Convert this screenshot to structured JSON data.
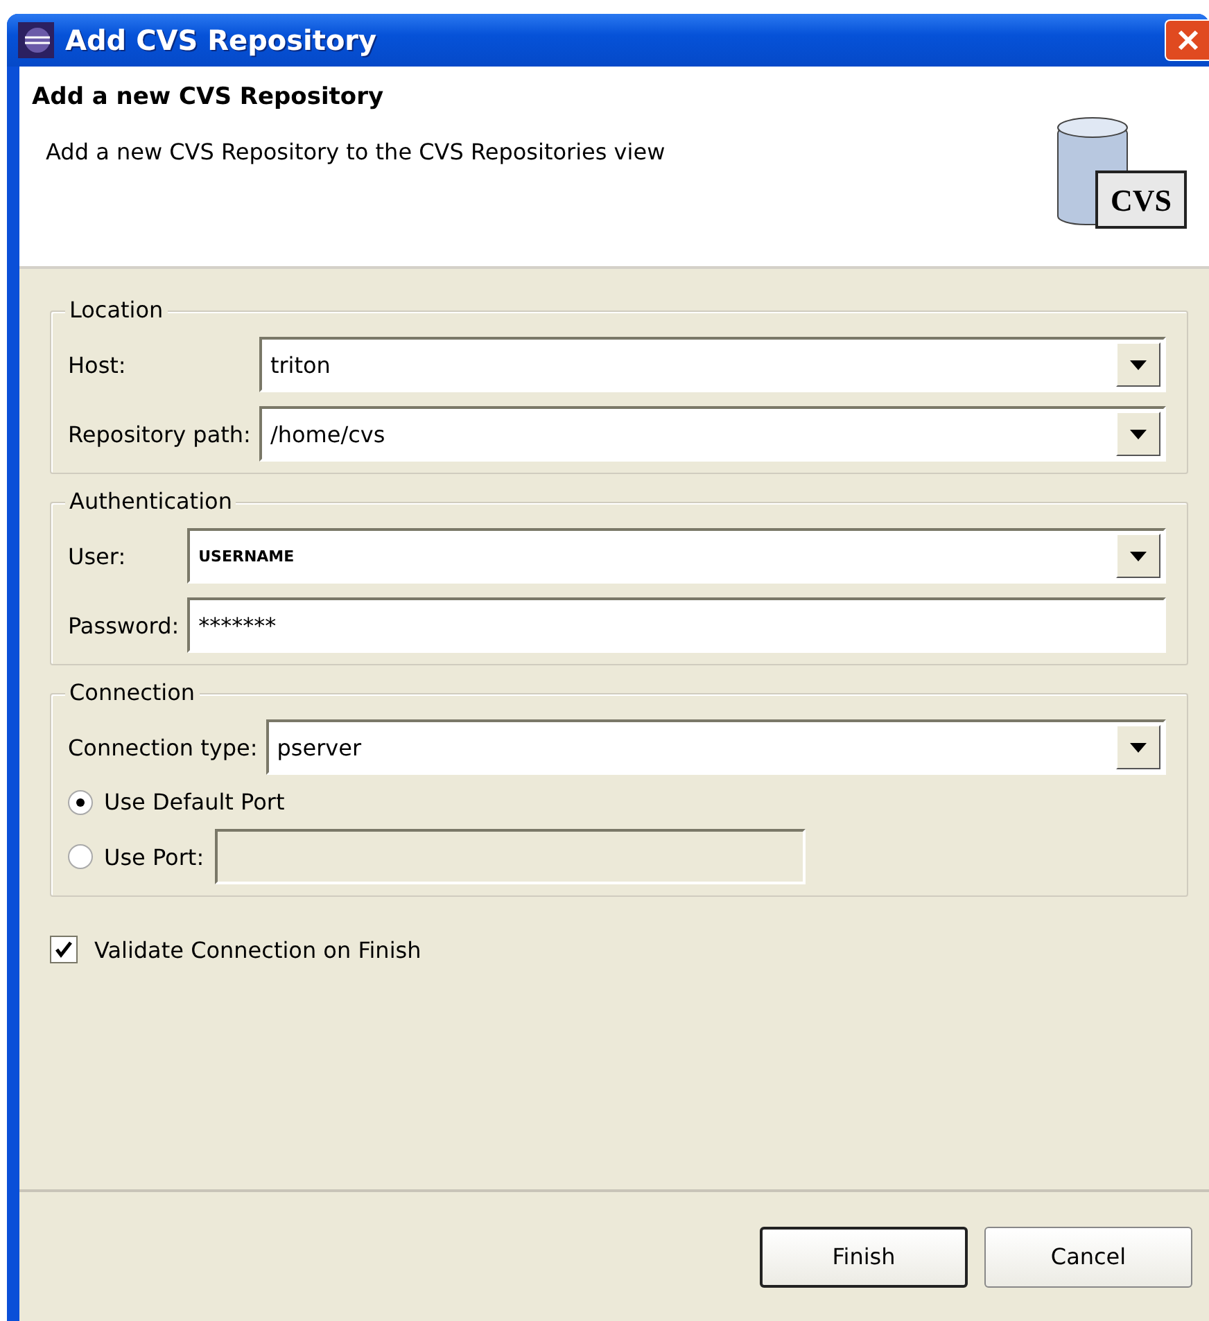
{
  "window": {
    "title": "Add CVS Repository"
  },
  "header": {
    "title": "Add a new CVS Repository",
    "description": "Add a new CVS Repository to the CVS Repositories view",
    "logo_text": "CVS"
  },
  "groups": [
    {
      "title": "Location",
      "rows": [
        {
          "kind": "combo",
          "label": "Host:",
          "value": "triton"
        },
        {
          "kind": "combo",
          "label": "Repository path:",
          "value": "/home/cvs"
        }
      ]
    },
    {
      "title": "Authentication",
      "rows": [
        {
          "kind": "combo",
          "label": "User:",
          "value": "USERNAME"
        },
        {
          "kind": "text",
          "label": "Password:",
          "value": "*******"
        }
      ]
    },
    {
      "title": "Connection",
      "rows": [
        {
          "kind": "combo",
          "label": "Connection type:",
          "value": "pserver"
        },
        {
          "kind": "radio",
          "label": "Use Default Port",
          "selected": true
        },
        {
          "kind": "radio_field",
          "label": "Use Port:",
          "selected": false,
          "disabled": true
        }
      ]
    }
  ],
  "validate": {
    "label": "Validate Connection on Finish",
    "checked": true
  },
  "buttons": [
    {
      "label": "Finish",
      "default": true
    },
    {
      "label": "Cancel",
      "default": false
    }
  ]
}
